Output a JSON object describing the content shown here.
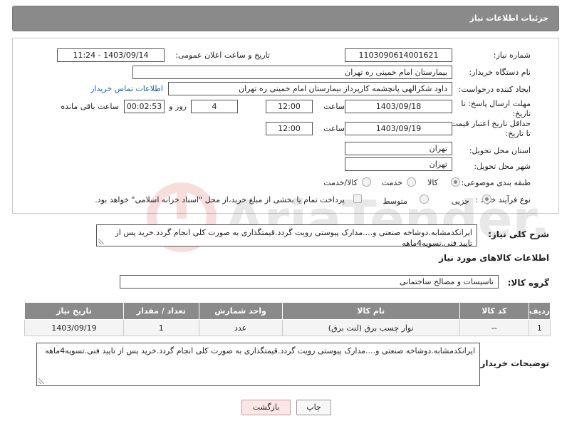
{
  "header": {
    "title": "جزئیات اطلاعات نیاز"
  },
  "form": {
    "need_number_label": "شماره نیاز:",
    "need_number": "1103090614001621",
    "announce_label": "تاریخ و ساعت اعلان عمومی:",
    "announce_value": "1403/09/14 - 11:24",
    "buyer_org_label": "نام دستگاه خریدار:",
    "buyer_org": "بیمارستان امام خمینی ره  تهران",
    "requester_label": "ایجاد کننده درخواست:",
    "requester": "داود شکرالهی پانچشمه کارپرداز بیمارستان امام خمینی ره  تهران",
    "contact_link": "اطلاعات تماس خریدار",
    "deadline_label": "مهلت ارسال پاسخ: تا تاریخ:",
    "deadline_date": "1403/09/18",
    "time_label": "ساعت",
    "deadline_time": "12:00",
    "days_value": "4",
    "days_label": "روز و",
    "remaining_value": "00:02:53",
    "remaining_label": "ساعت باقی مانده",
    "validity_label": "حداقل تاریخ اعتبار قیمت: تا تاریخ:",
    "validity_date": "1403/09/19",
    "validity_time": "12:00",
    "province_label": "استان محل تحویل:",
    "province": "تهران",
    "city_label": "شهر محل تحویل:",
    "city": "تهران",
    "category_label": "طبقه بندی موضوعی:",
    "category_options": [
      "کالا",
      "خدمت",
      "کالا/خدمت"
    ],
    "purchase_type_label": "نوع فرآیند خرید :",
    "purchase_options": [
      "جزیی",
      "متوسط"
    ],
    "payment_note": "پرداخت تمام یا بخشی از مبلغ خرید،از محل \"اسناد خزانه اسلامی\" خواهد بود."
  },
  "description": {
    "label": "شرح کلی نیاز:",
    "text": "ایرانکدمشابه.دوشاخه صنعتی و....مدارک پیوستی رویت گردد.قیمتگذاری به صورت کلی انجام گردد.خرید پس از تایید فنی.تسویه4ماهه"
  },
  "goods": {
    "section_title": "اطلاعات کالاهای مورد نیاز",
    "group_label": "گروه کالا:",
    "group_value": "تاسیسات و مصالح ساختمانی",
    "columns": [
      "ردیف",
      "کد کالا",
      "نام کالا",
      "واحد شمارش",
      "تعداد / مقدار",
      "تاریخ نیاز"
    ],
    "rows": [
      [
        "1",
        "--",
        "نوار چسب برق (لنت برق)",
        "عدد",
        "1",
        "1403/09/19"
      ]
    ]
  },
  "buyer_notes": {
    "label": "توضیحات خریدار:",
    "text": "ایرانکدمشابه.دوشاخه صنعتی و....مدارک پیوستی رویت گردد.قیمتگذاری به صورت کلی انجام گردد.خرید پس از تایید فنی.تسویه4ماهه"
  },
  "buttons": {
    "print": "چاپ",
    "back": "بازگشت"
  },
  "watermark": {
    "text": "AriaTender.neT"
  }
}
